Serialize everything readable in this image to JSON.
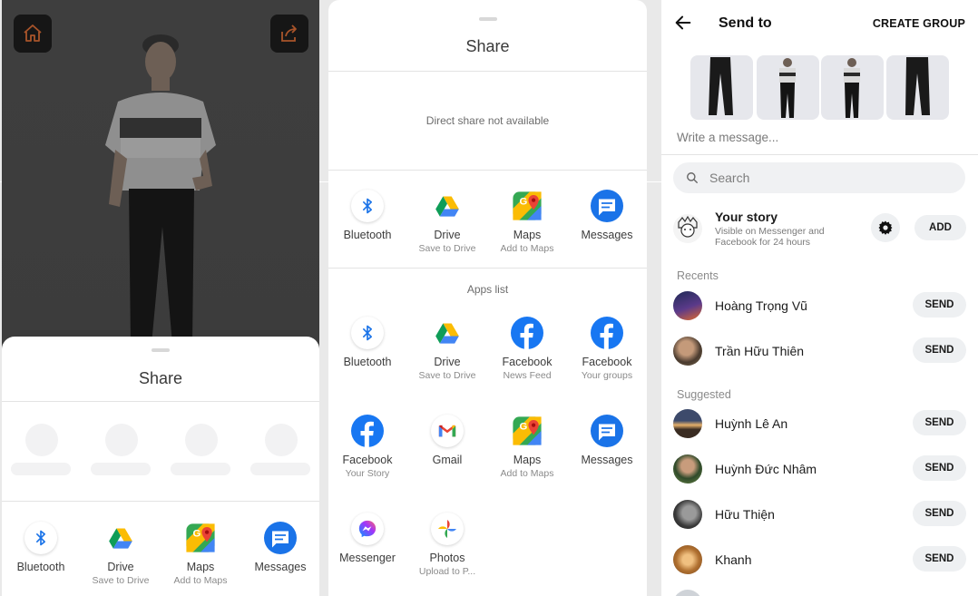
{
  "panel1": {
    "sheet_title": "Share",
    "apps": [
      {
        "label": "Bluetooth",
        "sub": "",
        "icon": "bluetooth-icon"
      },
      {
        "label": "Drive",
        "sub": "Save to Drive",
        "icon": "google-drive-icon"
      },
      {
        "label": "Maps",
        "sub": "Add to Maps",
        "icon": "google-maps-icon"
      },
      {
        "label": "Messages",
        "sub": "",
        "icon": "messages-icon"
      }
    ]
  },
  "panel2": {
    "sheet_title": "Share",
    "direct_share_note": "Direct share not available",
    "top_apps": [
      {
        "label": "Bluetooth",
        "sub": "",
        "icon": "bluetooth-icon"
      },
      {
        "label": "Drive",
        "sub": "Save to Drive",
        "icon": "google-drive-icon"
      },
      {
        "label": "Maps",
        "sub": "Add to Maps",
        "icon": "google-maps-icon"
      },
      {
        "label": "Messages",
        "sub": "",
        "icon": "messages-icon"
      }
    ],
    "apps_list_title": "Apps list",
    "apps_list": [
      {
        "label": "Bluetooth",
        "sub": "",
        "icon": "bluetooth-icon"
      },
      {
        "label": "Drive",
        "sub": "Save to Drive",
        "icon": "google-drive-icon"
      },
      {
        "label": "Facebook",
        "sub": "News Feed",
        "icon": "facebook-icon"
      },
      {
        "label": "Facebook",
        "sub": "Your groups",
        "icon": "facebook-icon"
      },
      {
        "label": "Facebook",
        "sub": "Your Story",
        "icon": "facebook-icon"
      },
      {
        "label": "Gmail",
        "sub": "",
        "icon": "gmail-icon"
      },
      {
        "label": "Maps",
        "sub": "Add to Maps",
        "icon": "google-maps-icon"
      },
      {
        "label": "Messages",
        "sub": "",
        "icon": "messages-icon"
      },
      {
        "label": "Messenger",
        "sub": "",
        "icon": "messenger-icon"
      },
      {
        "label": "Photos",
        "sub": "Upload to P...",
        "icon": "google-photos-icon"
      }
    ]
  },
  "panel3": {
    "title": "Send to",
    "create_group": "CREATE GROUP",
    "message_placeholder": "Write a message...",
    "search_placeholder": "Search",
    "story": {
      "name": "Your story",
      "desc_line1": "Visible on Messenger and",
      "desc_line2": "Facebook for 24 hours",
      "add_label": "ADD"
    },
    "recents_label": "Recents",
    "recents": [
      {
        "name": "Hoàng Trọng Vũ",
        "send": "SEND"
      },
      {
        "name": "Trần Hữu Thiên",
        "send": "SEND"
      }
    ],
    "suggested_label": "Suggested",
    "suggested": [
      {
        "name": "Huỳnh Lê An",
        "send": "SEND"
      },
      {
        "name": "Huỳnh Đức Nhâm",
        "send": "SEND"
      },
      {
        "name": "Hữu Thiện",
        "send": "SEND"
      },
      {
        "name": "Khanh",
        "send": "SEND"
      }
    ]
  }
}
